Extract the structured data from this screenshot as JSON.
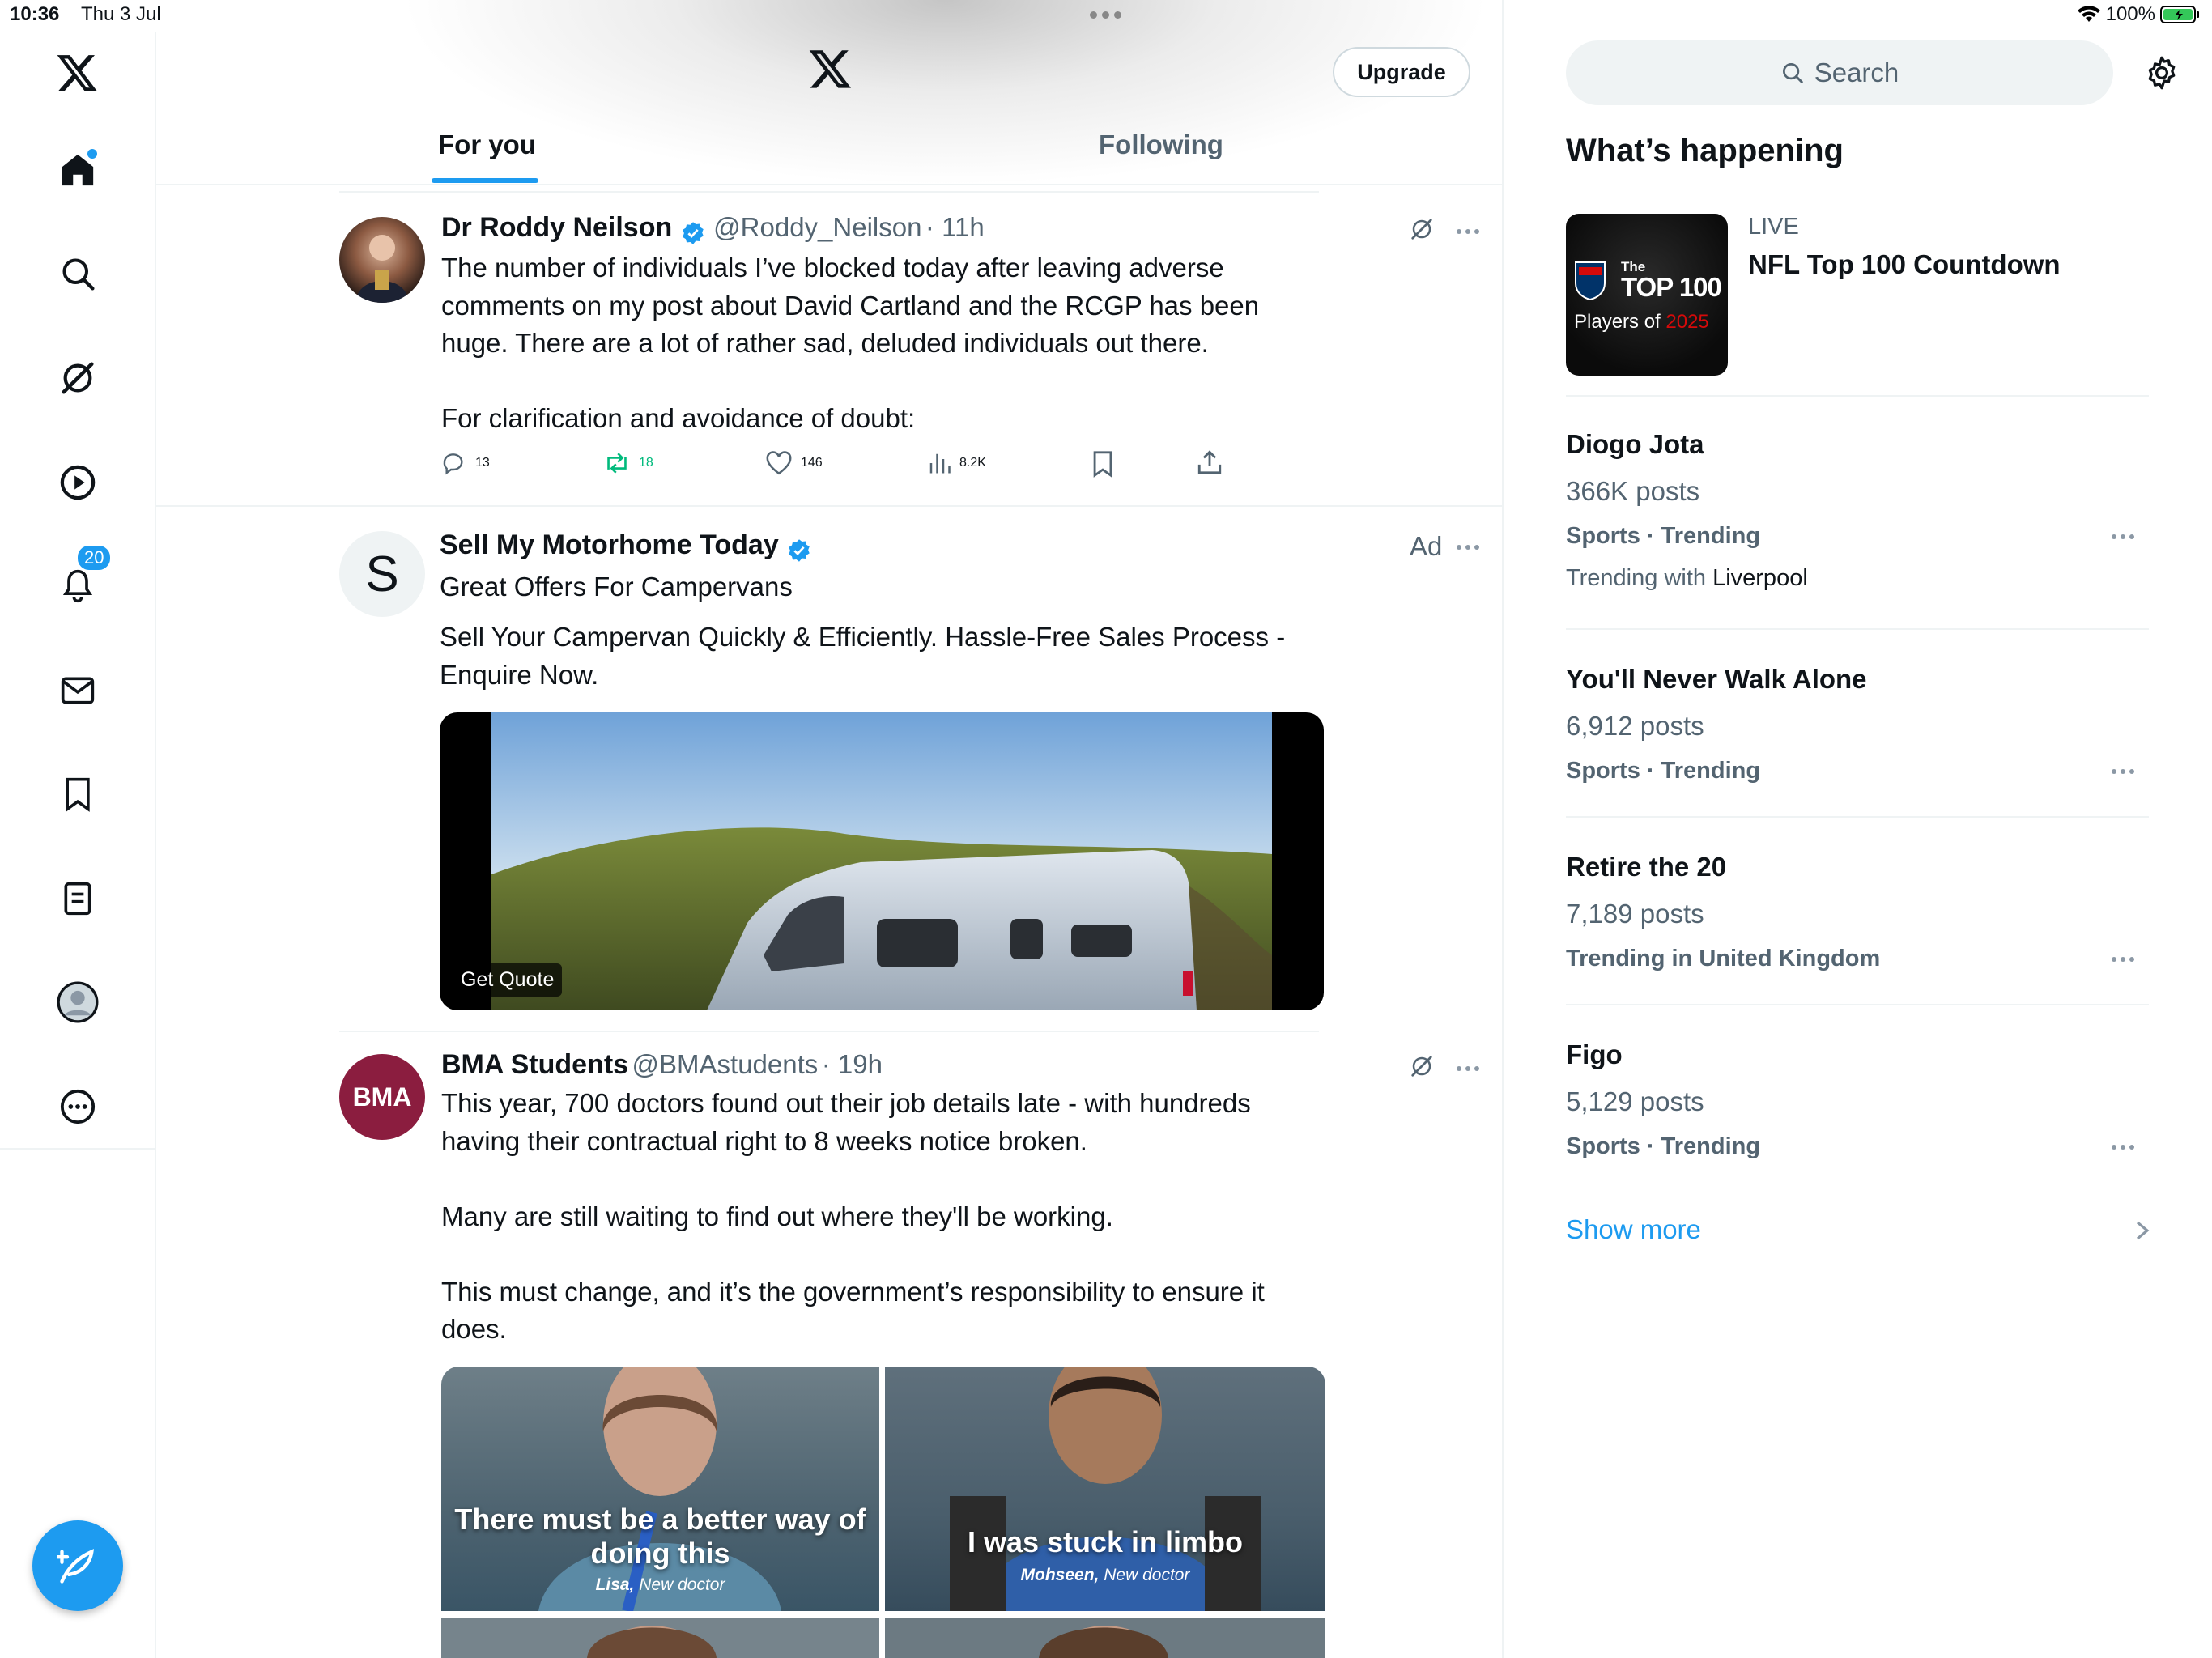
{
  "status_bar": {
    "time": "10:36",
    "date": "Thu 3 Jul",
    "battery": "100%"
  },
  "nav": {
    "notifications_badge": "20",
    "items": [
      "home-icon",
      "search-icon",
      "grok-icon",
      "play-icon",
      "bell-icon",
      "mail-icon",
      "bookmark-icon",
      "list-icon",
      "profile-icon",
      "more-icon"
    ]
  },
  "header": {
    "upgrade_label": "Upgrade",
    "tabs": [
      {
        "label": "For you",
        "active": true
      },
      {
        "label": "Following",
        "active": false
      }
    ]
  },
  "feed": [
    {
      "name": "Dr Roddy Neilson",
      "handle": "@Roddy_Neilson",
      "time": "· 11h",
      "text": "The number of individuals I’ve blocked today after leaving  adverse\ncomments on my post about David Cartland and the RCGP has been\nhuge. There are a lot of rather sad, deluded individuals out there.\n\nFor clarification and avoidance of doubt:",
      "replies": "13",
      "reposts": "18",
      "likes": "146",
      "views": "8.2K"
    },
    {
      "avatar_letter": "S",
      "name": "Sell My Motorhome Today",
      "ad_label": "Ad",
      "subtitle": "Great Offers For Campervans",
      "text": "Sell Your Campervan Quickly & Efficiently. Hassle-Free Sales Process -\nEnquire Now.",
      "cta": "Get Quote"
    },
    {
      "avatar_text": "BMA",
      "name": "BMA Students",
      "handle": "@BMAstudents",
      "time": "· 19h",
      "text": "This year, 700 doctors found out their job details late - with hundreds\nhaving their contractual right to 8 weeks notice broken.\n\nMany are still waiting to find out where they'll be working.\n\nThis must change, and it’s the government’s responsibility to ensure it\ndoes.",
      "images": [
        {
          "quote": "There must be a better way of doing this",
          "attribution_name": "Lisa,",
          "attribution_role": "New doctor"
        },
        {
          "quote": "I was stuck in limbo",
          "attribution_name": "Mohseen,",
          "attribution_role": "New doctor"
        }
      ]
    }
  ],
  "sidebar": {
    "search_placeholder": "Search",
    "heading": "What’s happening",
    "live": {
      "label": "LIVE",
      "title": "NFL Top 100 Countdown",
      "thumb_the": "The",
      "thumb_top": "TOP 100",
      "thumb_players": "Players of",
      "thumb_year": "2025"
    },
    "trends": [
      {
        "title": "Diogo Jota",
        "posts": "366K posts",
        "category": "Sports · Trending",
        "with_prefix": "Trending with",
        "with_value": "Liverpool"
      },
      {
        "title": "You'll Never Walk Alone",
        "posts": "6,912 posts",
        "category": "Sports · Trending"
      },
      {
        "title": "Retire the 20",
        "posts": "7,189 posts",
        "category": "Trending in United Kingdom"
      },
      {
        "title": "Figo",
        "posts": "5,129 posts",
        "category": "Sports · Trending"
      }
    ],
    "show_more": "Show more"
  },
  "colors": {
    "accent": "#1d9bf0",
    "repost_green": "#00ba7c",
    "text": "#0f1419",
    "muted": "#536471"
  }
}
